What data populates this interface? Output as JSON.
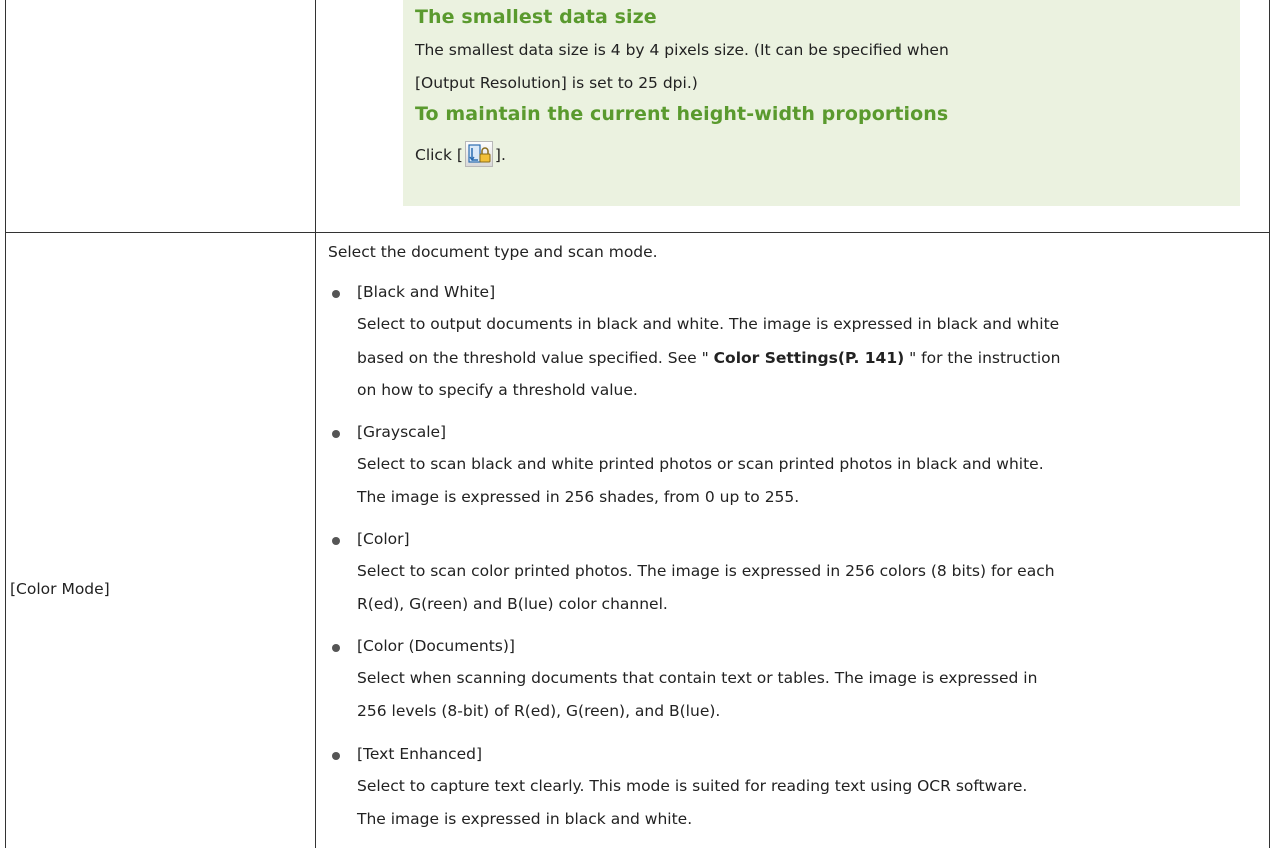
{
  "note": {
    "heading1": "The smallest data size",
    "text1_line1": "The smallest data size is 4 by 4 pixels size. (It can be specified when",
    "text1_line2": "[Output Resolution] is set to 25 dpi.)",
    "heading2": "To maintain the current height-width proportions",
    "click_prefix": "Click [",
    "click_suffix": "].",
    "lock_icon": "keep-ratio-lock-icon"
  },
  "row": {
    "label": "[Color Mode]",
    "intro": "Select the document type and scan mode.",
    "items": [
      {
        "title": "[Black and White]",
        "lines": [
          "Select to output documents in black and white. The image is expressed in black and white",
          "based on the threshold value specified. See \" ",
          "Color Settings(P. 141)",
          " \" for the instruction",
          "on how to specify a threshold value."
        ]
      },
      {
        "title": "[Grayscale]",
        "lines": [
          "Select to scan black and white printed photos or scan printed photos in black and white.",
          "The image is expressed in 256 shades, from 0 up to 255."
        ]
      },
      {
        "title": "[Color]",
        "lines": [
          "Select to scan color printed photos. The image is expressed in 256 colors (8 bits) for each",
          "R(ed), G(reen) and B(lue) color channel."
        ]
      },
      {
        "title": "[Color (Documents)]",
        "lines": [
          "Select when scanning documents that contain text or tables. The image is expressed in",
          "256 levels (8-bit) of R(ed), G(reen), and B(lue)."
        ]
      },
      {
        "title": "[Text Enhanced]",
        "lines": [
          "Select to capture text clearly. This mode is suited for reading text using OCR software.",
          "The image is expressed in black and white."
        ]
      }
    ]
  },
  "colors": {
    "heading_green": "#5a9a2e",
    "note_bg": "#ebf2e0",
    "border": "#333333"
  }
}
